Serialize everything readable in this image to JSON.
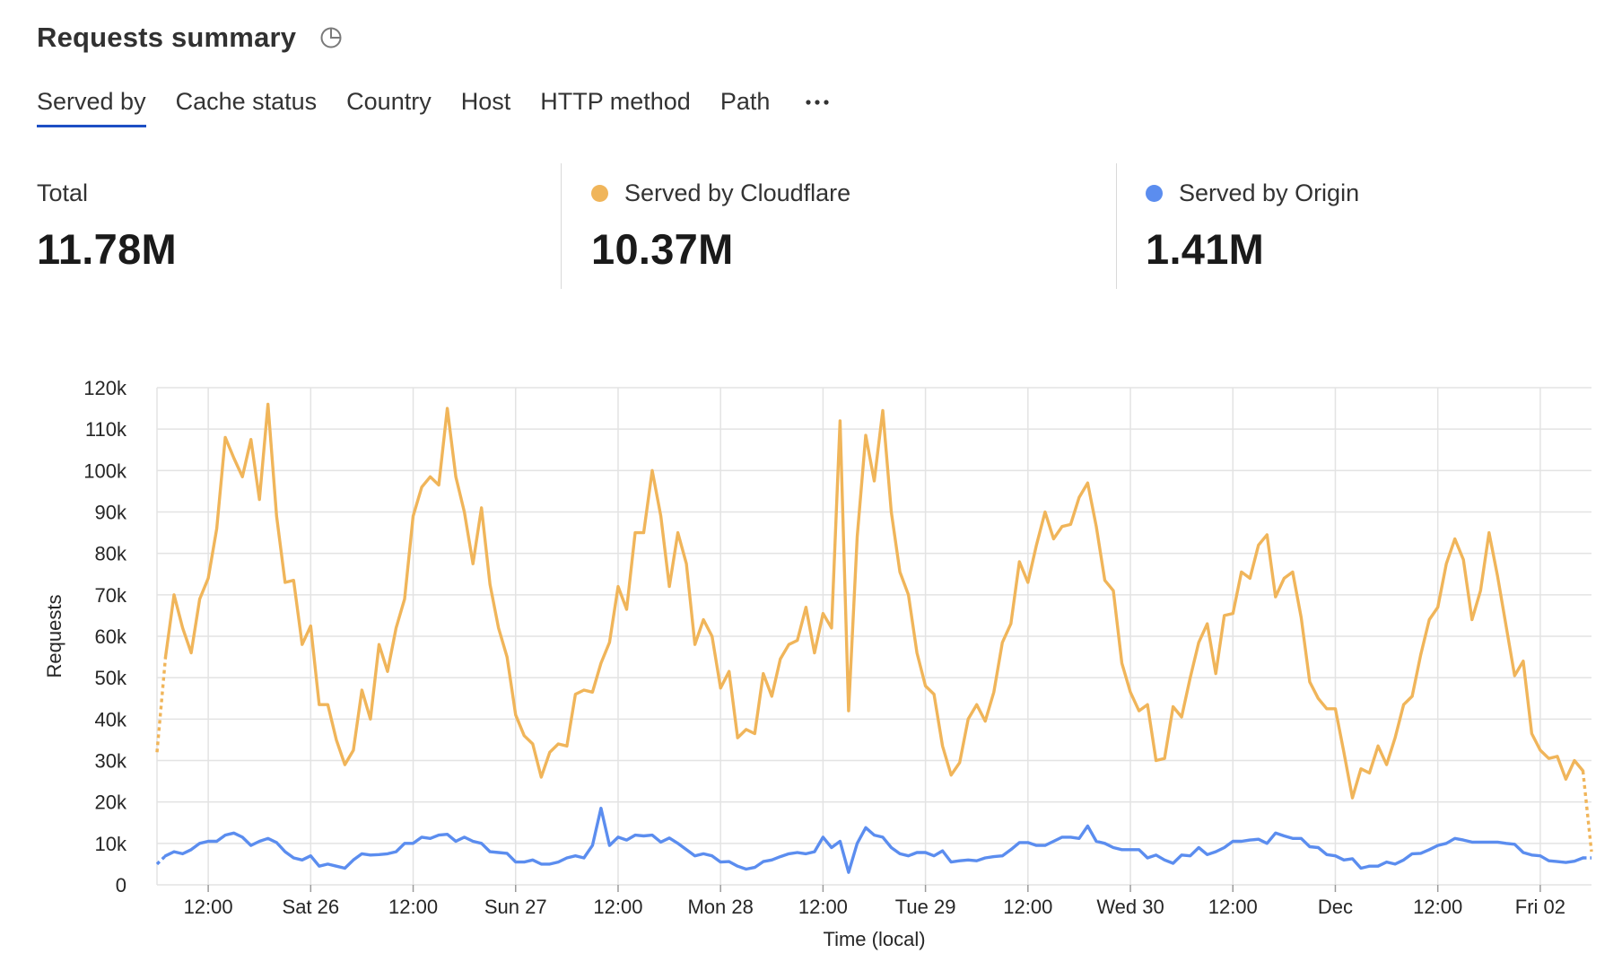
{
  "header": {
    "title": "Requests summary"
  },
  "tabs": [
    {
      "label": "Served by",
      "active": true
    },
    {
      "label": "Cache status",
      "active": false
    },
    {
      "label": "Country",
      "active": false
    },
    {
      "label": "Host",
      "active": false
    },
    {
      "label": "HTTP method",
      "active": false
    },
    {
      "label": "Path",
      "active": false
    }
  ],
  "stats": {
    "total": {
      "label": "Total",
      "value": "11.78M"
    },
    "cloudflare": {
      "label": "Served by Cloudflare",
      "value": "10.37M",
      "color": "#f0b55a"
    },
    "origin": {
      "label": "Served by Origin",
      "value": "1.41M",
      "color": "#5b8def"
    }
  },
  "colors": {
    "accent": "#1d4fc4",
    "cloudflare": "#f0b55a",
    "origin": "#5b8def"
  },
  "chart_data": {
    "type": "line",
    "xlabel": "Time (local)",
    "ylabel": "Requests",
    "ylim": [
      0,
      120000
    ],
    "yticks": [
      "0",
      "10k",
      "20k",
      "30k",
      "40k",
      "50k",
      "60k",
      "70k",
      "80k",
      "90k",
      "100k",
      "110k",
      "120k"
    ],
    "x_ticks": [
      "12:00",
      "Sat 26",
      "12:00",
      "Sun 27",
      "12:00",
      "Mon 28",
      "12:00",
      "Tue 29",
      "12:00",
      "Wed 30",
      "12:00",
      "Dec",
      "12:00",
      "Fri 02"
    ],
    "x_start": "Fri 25 06:00",
    "x_interval_hours": 1,
    "grid": true,
    "series": [
      {
        "name": "Served by Cloudflare",
        "color": "#f0b55a",
        "values": [
          32000,
          55000,
          70000,
          62000,
          56000,
          69000,
          74000,
          86000,
          108000,
          103000,
          98500,
          107500,
          93000,
          116000,
          89000,
          73000,
          73500,
          58000,
          62500,
          43500,
          43500,
          35000,
          29000,
          32500,
          47000,
          40000,
          58000,
          51500,
          62000,
          69000,
          89000,
          96000,
          98500,
          96500,
          115000,
          98500,
          90000,
          77500,
          91000,
          72500,
          62000,
          55000,
          41000,
          36000,
          34000,
          26000,
          32000,
          34000,
          33500,
          46000,
          47000,
          46500,
          53500,
          58500,
          72000,
          66500,
          85000,
          85000,
          100000,
          89000,
          72000,
          85000,
          77500,
          58000,
          64000,
          60000,
          47500,
          51500,
          35500,
          37500,
          36500,
          51000,
          45500,
          54500,
          58000,
          59000,
          67000,
          56000,
          65500,
          62000,
          112000,
          42000,
          84000,
          108500,
          97500,
          114500,
          90000,
          75500,
          70000,
          56000,
          48000,
          46000,
          33500,
          26500,
          29500,
          40000,
          43500,
          39500,
          46500,
          58500,
          63000,
          78000,
          73000,
          82000,
          90000,
          83500,
          86500,
          87000,
          93500,
          97000,
          86500,
          73500,
          71000,
          53500,
          46500,
          42000,
          43500,
          30000,
          30500,
          43000,
          40500,
          50000,
          58500,
          63000,
          51000,
          65000,
          65500,
          75500,
          74000,
          82000,
          84500,
          69500,
          74000,
          75500,
          64500,
          49000,
          45000,
          42500,
          42500,
          32000,
          21000,
          28000,
          27000,
          33500,
          29000,
          35500,
          43500,
          45500,
          55500,
          64000,
          67000,
          77500,
          83500,
          78500,
          64000,
          71000,
          85000,
          74500,
          62500,
          50500,
          54000,
          36500,
          32500,
          30500,
          31000,
          25500,
          30000,
          27500,
          8000
        ]
      },
      {
        "name": "Served by Origin",
        "color": "#5b8def",
        "values": [
          5000,
          7000,
          8000,
          7500,
          8500,
          10000,
          10500,
          10500,
          12000,
          12500,
          11500,
          9500,
          10500,
          11200,
          10200,
          8000,
          6500,
          6000,
          7000,
          4500,
          5000,
          4500,
          4000,
          6000,
          7500,
          7200,
          7300,
          7500,
          8000,
          10000,
          10000,
          11500,
          11200,
          12000,
          12200,
          10500,
          11500,
          10500,
          10000,
          8000,
          7800,
          7600,
          5500,
          5500,
          6000,
          5000,
          5000,
          5500,
          6500,
          7000,
          6500,
          9500,
          18500,
          9500,
          11500,
          10800,
          12000,
          11800,
          12000,
          10300,
          11300,
          10000,
          8500,
          7000,
          7500,
          7000,
          5500,
          5600,
          4500,
          3800,
          4200,
          5600,
          6000,
          6800,
          7500,
          7800,
          7500,
          8000,
          11500,
          9000,
          10500,
          3000,
          10000,
          13800,
          12000,
          11500,
          9000,
          7500,
          7000,
          7800,
          7800,
          7000,
          8200,
          5500,
          5800,
          6000,
          5800,
          6500,
          6800,
          7000,
          8500,
          10200,
          10200,
          9500,
          9500,
          10500,
          11500,
          11500,
          11200,
          14200,
          10500,
          10000,
          9000,
          8500,
          8500,
          8500,
          6500,
          7200,
          6000,
          5200,
          7200,
          7000,
          9000,
          7300,
          8000,
          9000,
          10500,
          10500,
          10800,
          11000,
          10000,
          12500,
          11800,
          11200,
          11200,
          9200,
          9000,
          7300,
          7000,
          6000,
          6300,
          4000,
          4500,
          4500,
          5500,
          5000,
          6000,
          7500,
          7600,
          8500,
          9500,
          10000,
          11200,
          10800,
          10300,
          10300,
          10300,
          10300,
          10000,
          9800,
          7800,
          7200,
          7000,
          5800,
          5600,
          5400,
          5700,
          6500,
          6500,
          2000
        ]
      }
    ]
  }
}
